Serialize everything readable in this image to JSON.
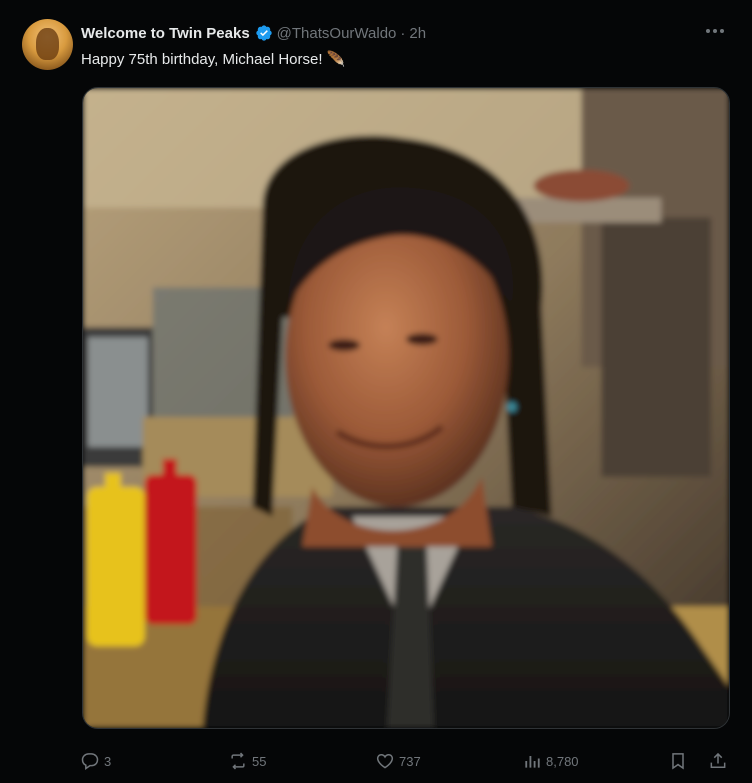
{
  "tweet": {
    "display_name": "Welcome to Twin Peaks",
    "handle": "@ThatsOurWaldo",
    "separator": "·",
    "time": "2h",
    "text": "Happy 75th birthday, Michael Horse! 🪶",
    "media_description_icon": "photo"
  },
  "actions": {
    "reply_count": "3",
    "retweet_count": "55",
    "like_count": "737",
    "view_count": "8,780"
  },
  "colors": {
    "background": "#050607",
    "text_primary": "#e7e9ea",
    "text_secondary": "#71767b",
    "verified_badge": "#1d9bf0"
  },
  "icons": {
    "verified": "verified-badge-icon",
    "more": "more-icon",
    "reply": "reply-icon",
    "retweet": "retweet-icon",
    "like": "heart-icon",
    "views": "views-icon",
    "bookmark": "bookmark-icon",
    "share": "share-icon"
  }
}
